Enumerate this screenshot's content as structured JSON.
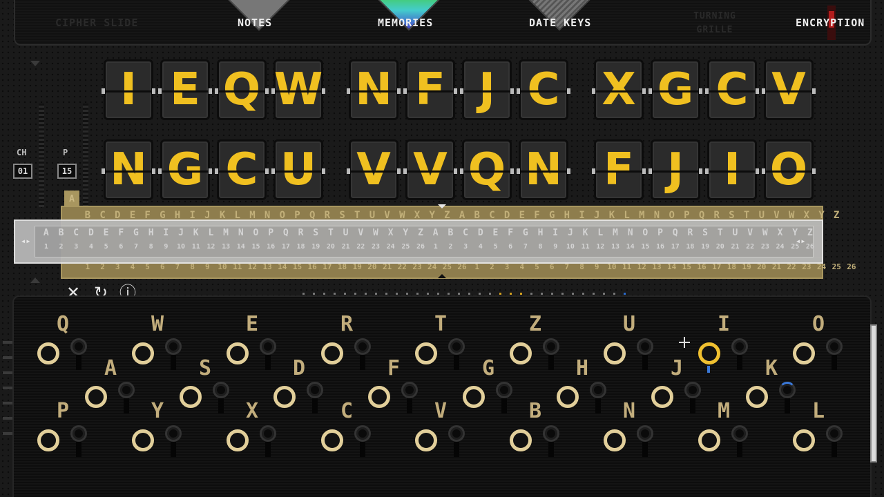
{
  "tabs": {
    "cipher_slide": "CIPHER SLIDE",
    "notes": "NOTES",
    "memories": "MEMORIES",
    "date_keys": "DATE KEYS",
    "turning": "TURNING",
    "grille": "GRILLE",
    "encryption": "ENCRYPTION"
  },
  "flaps_row1": [
    "I",
    "E",
    "Q",
    "W",
    "N",
    "F",
    "J",
    "C",
    "X",
    "G",
    "C",
    "V"
  ],
  "flaps_row2": [
    "N",
    "G",
    "C",
    "U",
    "V",
    "V",
    "Q",
    "N",
    "F",
    "J",
    "I",
    "O"
  ],
  "controls": {
    "ch_label": "CH",
    "ch_value": "01",
    "p_label": "P",
    "p_value": "15"
  },
  "slide": {
    "tab_letter": "A",
    "top_letters": [
      "B",
      "C",
      "D",
      "E",
      "F",
      "G",
      "H",
      "I",
      "J",
      "K",
      "L",
      "M",
      "N",
      "O",
      "P",
      "Q",
      "R",
      "S",
      "T",
      "U",
      "V",
      "W",
      "X",
      "Y",
      "Z",
      "A",
      "B",
      "C",
      "D",
      "E",
      "F",
      "G",
      "H",
      "I",
      "J",
      "K",
      "L",
      "M",
      "N",
      "O",
      "P",
      "Q",
      "R",
      "S",
      "T",
      "U",
      "V",
      "W",
      "X",
      "Y",
      "Z"
    ],
    "bottom_numbers": [
      "1",
      "2",
      "3",
      "4",
      "5",
      "6",
      "7",
      "8",
      "9",
      "10",
      "11",
      "12",
      "13",
      "14",
      "15",
      "16",
      "17",
      "18",
      "19",
      "20",
      "21",
      "22",
      "23",
      "24",
      "25",
      "26",
      "1",
      "2",
      "3",
      "4",
      "5",
      "6",
      "7",
      "8",
      "9",
      "10",
      "11",
      "12",
      "13",
      "14",
      "15",
      "16",
      "17",
      "18",
      "19",
      "20",
      "21",
      "22",
      "23",
      "24",
      "25",
      "26"
    ],
    "grey_letters": [
      "A",
      "B",
      "C",
      "D",
      "E",
      "F",
      "G",
      "H",
      "I",
      "J",
      "K",
      "L",
      "M",
      "N",
      "O",
      "P",
      "Q",
      "R",
      "S",
      "T",
      "U",
      "V",
      "W",
      "X",
      "Y",
      "Z",
      "A",
      "B",
      "C",
      "D",
      "E",
      "F",
      "G",
      "H",
      "I",
      "J",
      "K",
      "L",
      "M",
      "N",
      "O",
      "P",
      "Q",
      "R",
      "S",
      "T",
      "U",
      "V",
      "W",
      "X",
      "Y",
      "Z"
    ],
    "grey_numbers": [
      "1",
      "2",
      "3",
      "4",
      "5",
      "6",
      "7",
      "8",
      "9",
      "10",
      "11",
      "12",
      "13",
      "14",
      "15",
      "16",
      "17",
      "18",
      "19",
      "20",
      "21",
      "22",
      "23",
      "24",
      "25",
      "26",
      "1",
      "2",
      "3",
      "4",
      "5",
      "6",
      "7",
      "8",
      "9",
      "10",
      "11",
      "12",
      "13",
      "14",
      "15",
      "16",
      "17",
      "18",
      "19",
      "20",
      "21",
      "22",
      "23",
      "24",
      "25",
      "26"
    ]
  },
  "actions": {
    "clear": "✕",
    "reset": "↻",
    "info": "ⓘ"
  },
  "plugboard": {
    "row1": [
      "Q",
      "W",
      "E",
      "R",
      "T",
      "Z",
      "U",
      "I",
      "O"
    ],
    "row2": [
      "A",
      "S",
      "D",
      "F",
      "G",
      "H",
      "J",
      "K"
    ],
    "row3": [
      "P",
      "Y",
      "X",
      "C",
      "V",
      "B",
      "N",
      "M",
      "L"
    ]
  },
  "colors": {
    "flap_text": "#f0c020",
    "slide_brass": "#8e7d4d",
    "socket_ring": "#e2cf9a",
    "plug_blue": "#3a78d8"
  }
}
